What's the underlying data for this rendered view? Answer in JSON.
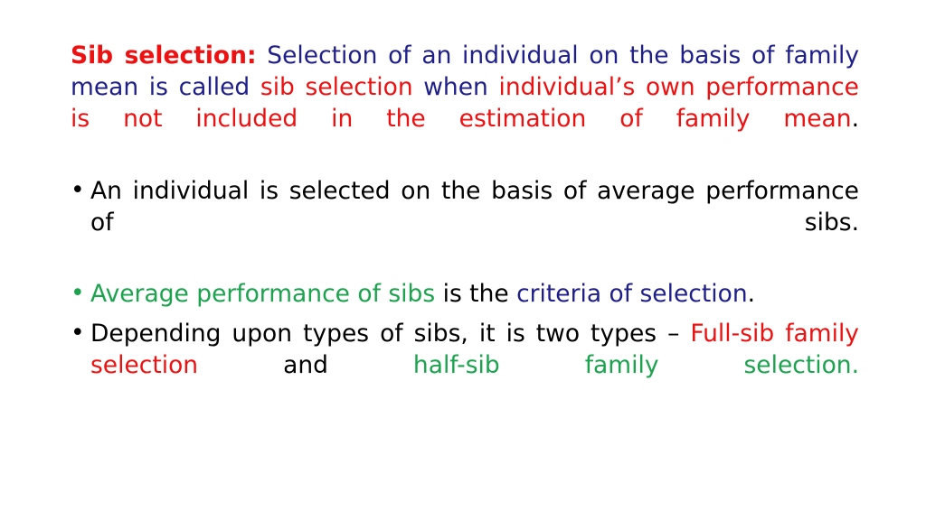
{
  "slide": {
    "background_color": "#ffffff",
    "colors": {
      "red": "#ee1111",
      "blue": "#1f1f8c",
      "green": "#1ba34e",
      "black": "#000000"
    },
    "bullet_glyph": "•",
    "intro_paragraph": {
      "segments": [
        {
          "text": "Sib selection:",
          "color": "red",
          "bold": true
        },
        {
          "text": " Selection of an individual on the basis of family mean is called ",
          "color": "blue",
          "bold": false
        },
        {
          "text": "sib selection",
          "color": "red",
          "bold": false
        },
        {
          "text": " when ",
          "color": "blue",
          "bold": false
        },
        {
          "text": "individual’s own performance is not included in the estimation of family mean",
          "color": "red",
          "bold": false
        },
        {
          "text": ".",
          "color": "black",
          "bold": false
        }
      ],
      "plain_text": "Sib selection: Selection of an individual on the basis of family mean is called sib selection when individual’s own performance is not included in the estimation of family mean."
    },
    "bullets": [
      {
        "marker": "•",
        "marker_color": "black",
        "segments": [
          {
            "text": "An individual is selected on the basis of average performance of sibs.",
            "color": "black",
            "bold": false
          }
        ],
        "plain_text": "An individual is selected on the basis of average performance of sibs."
      },
      {
        "marker": "•",
        "marker_color": "green",
        "segments": [
          {
            "text": "Average performance of sibs",
            "color": "green",
            "bold": false
          },
          {
            "text": " is the ",
            "color": "black",
            "bold": false
          },
          {
            "text": "criteria of selection",
            "color": "blue",
            "bold": false
          },
          {
            "text": ".",
            "color": "black",
            "bold": false
          }
        ],
        "plain_text": "Average performance of sibs is the criteria of selection."
      },
      {
        "marker": "•",
        "marker_color": "black",
        "segments": [
          {
            "text": "Depending upon types of sibs, it is two types – ",
            "color": "black",
            "bold": false
          },
          {
            "text": "Full-sib family selection",
            "color": "red",
            "bold": false
          },
          {
            "text": " and ",
            "color": "black",
            "bold": false
          },
          {
            "text": "half-sib family selection.",
            "color": "green",
            "bold": false
          }
        ],
        "plain_text": "Depending upon types of sibs, it is two types – Full-sib family selection and half-sib family selection."
      }
    ]
  },
  "text": {
    "intro": {
      "s0": "Sib selection:",
      "s1": " Selection of an individual on the basis of family mean is called ",
      "s2": "sib selection",
      "s3": " when ",
      "s4": "individual’s own performance is not included in the estimation of family mean",
      "s5": "."
    },
    "b1": {
      "marker": "•",
      "s0": "An individual is selected on the basis of average performance of sibs."
    },
    "b2": {
      "marker": "•",
      "s0": "Average performance of sibs",
      "s1": " is the ",
      "s2": "criteria of selection",
      "s3": "."
    },
    "b3": {
      "marker": "•",
      "s0": "Depending upon types of sibs, it is two types – ",
      "s1": "Full-sib family selection",
      "s2": " and ",
      "s3": "half-sib family selection."
    }
  }
}
